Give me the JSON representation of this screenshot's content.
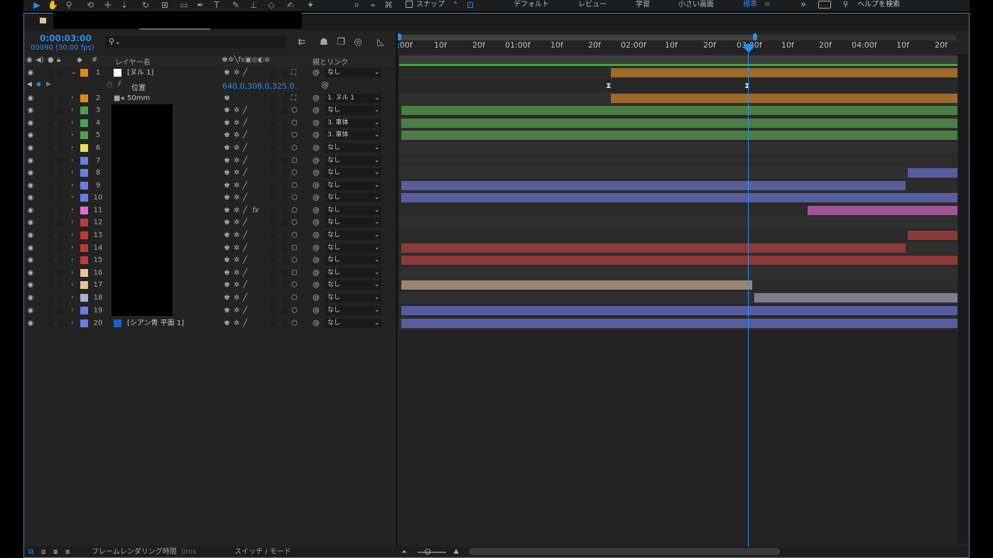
{
  "toolbar": {
    "snap_label": "スナップ",
    "workspaces": [
      "デフォルト",
      "レビュー",
      "学習",
      "小さい画面",
      "標準"
    ],
    "overflow_label": "»",
    "help_search_placeholder": "ヘルプを検索"
  },
  "timeline": {
    "timecode": "0:00:03:00",
    "frame_info": "00090 (30.00 fps)",
    "search_placeholder": "",
    "ruler_ticks": [
      ":00f",
      "10f",
      "20f",
      "01:00f",
      "10f",
      "20f",
      "02:00f",
      "10f",
      "20f",
      "03:00f",
      "10f",
      "20f",
      "04:00f",
      "10f",
      "20f"
    ],
    "columns": {
      "hash": "#",
      "layer_name": "レイヤー名",
      "parent_link": "親とリンク"
    },
    "property_row": {
      "name": "位置",
      "value": "640.0,308.0,325.0"
    },
    "layers": [
      {
        "num": "1",
        "label_color": "#e08a12",
        "name": "[ヌル 1]",
        "parent": "なし",
        "expanded": true,
        "bar_start": 0.3749,
        "bar_end": 1.0,
        "bar_color": "#9c6a2a"
      },
      {
        "num": "2",
        "label_color": "#e08a12",
        "name": "50mm",
        "parent": "1. ヌル 1",
        "bar_start": 0.3749,
        "bar_end": 1.0,
        "bar_color": "#9c6a2a"
      },
      {
        "num": "3",
        "label_color": "#4fa04f",
        "name": "",
        "parent": "なし",
        "bar_start": 0.0,
        "bar_end": 1.0,
        "bar_color": "#4b7f45"
      },
      {
        "num": "4",
        "label_color": "#4fa04f",
        "name": "",
        "parent": "3. 車体",
        "bar_start": 0.0,
        "bar_end": 1.0,
        "bar_color": "#4b7f45"
      },
      {
        "num": "5",
        "label_color": "#4fa04f",
        "name": "",
        "parent": "3. 車体",
        "bar_start": 0.0,
        "bar_end": 1.0,
        "bar_color": "#4b7f45"
      },
      {
        "num": "6",
        "label_color": "#e6e05a",
        "name": "",
        "parent": "なし",
        "bar_start": null,
        "bar_end": null,
        "bar_color": ""
      },
      {
        "num": "7",
        "label_color": "#6d7de0",
        "name": "",
        "parent": "なし",
        "bar_start": null,
        "bar_end": null,
        "bar_color": ""
      },
      {
        "num": "8",
        "label_color": "#6d7de0",
        "name": "",
        "parent": "なし",
        "bar_start": 0.9072,
        "bar_end": 1.0,
        "bar_color": "#565ea0"
      },
      {
        "num": "9",
        "label_color": "#6d7de0",
        "name": "",
        "parent": "なし",
        "bar_start": 0.0,
        "bar_end": 0.9072,
        "bar_color": "#565ea0"
      },
      {
        "num": "10",
        "label_color": "#6d7de0",
        "name": "",
        "parent": "なし",
        "bar_start": 0.0,
        "bar_end": 1.0,
        "bar_color": "#565ea0"
      },
      {
        "num": "11",
        "label_color": "#e06ad6",
        "name": "",
        "parent": "なし",
        "fx": true,
        "bar_start": 0.7276,
        "bar_end": 1.0,
        "bar_color": "#a15595"
      },
      {
        "num": "12",
        "label_color": "#c03838",
        "name": "",
        "parent": "なし",
        "bar_start": null,
        "bar_end": null,
        "bar_color": ""
      },
      {
        "num": "13",
        "label_color": "#c03838",
        "name": "",
        "parent": "なし",
        "bar_start": 0.9072,
        "bar_end": 1.0,
        "bar_color": "#8a3a3a"
      },
      {
        "num": "14",
        "label_color": "#c03838",
        "name": "",
        "parent": "なし",
        "bar_start": 0.0,
        "bar_end": 0.9072,
        "bar_color": "#8a3a3a"
      },
      {
        "num": "15",
        "label_color": "#c03838",
        "name": "",
        "parent": "なし",
        "bar_start": 0.0,
        "bar_end": 1.0,
        "bar_color": "#8a3a3a"
      },
      {
        "num": "16",
        "label_color": "#e8c29a",
        "name": "",
        "parent": "なし",
        "bar_start": null,
        "bar_end": null,
        "bar_color": ""
      },
      {
        "num": "17",
        "label_color": "#e8c29a",
        "name": "",
        "parent": "なし",
        "bar_start": 0.0,
        "bar_end": 0.6319,
        "bar_color": "#9c8573"
      },
      {
        "num": "18",
        "label_color": "#aab0d0",
        "name": "",
        "parent": "なし",
        "bar_start": 0.6319,
        "bar_end": 1.0,
        "bar_color": "#7d7f90"
      },
      {
        "num": "19",
        "label_color": "#6d7de0",
        "name": "",
        "parent": "なし",
        "bar_start": 0.0,
        "bar_end": 1.0,
        "bar_color": "#565ea0"
      },
      {
        "num": "20",
        "label_color": "#6d7de0",
        "name": "[シアン青 平面 1]",
        "parent": "なし",
        "solid": true,
        "bar_start": 0.0,
        "bar_end": 1.0,
        "bar_color": "#565ea0"
      }
    ],
    "bottom": {
      "render_time_label": "フレームレンダリング時間",
      "render_time_value": "0ms",
      "switch_mode_label": "スイッチ / モード"
    }
  },
  "colors": {
    "accent": "#2d8ceb",
    "panel_bg": "#232323"
  }
}
